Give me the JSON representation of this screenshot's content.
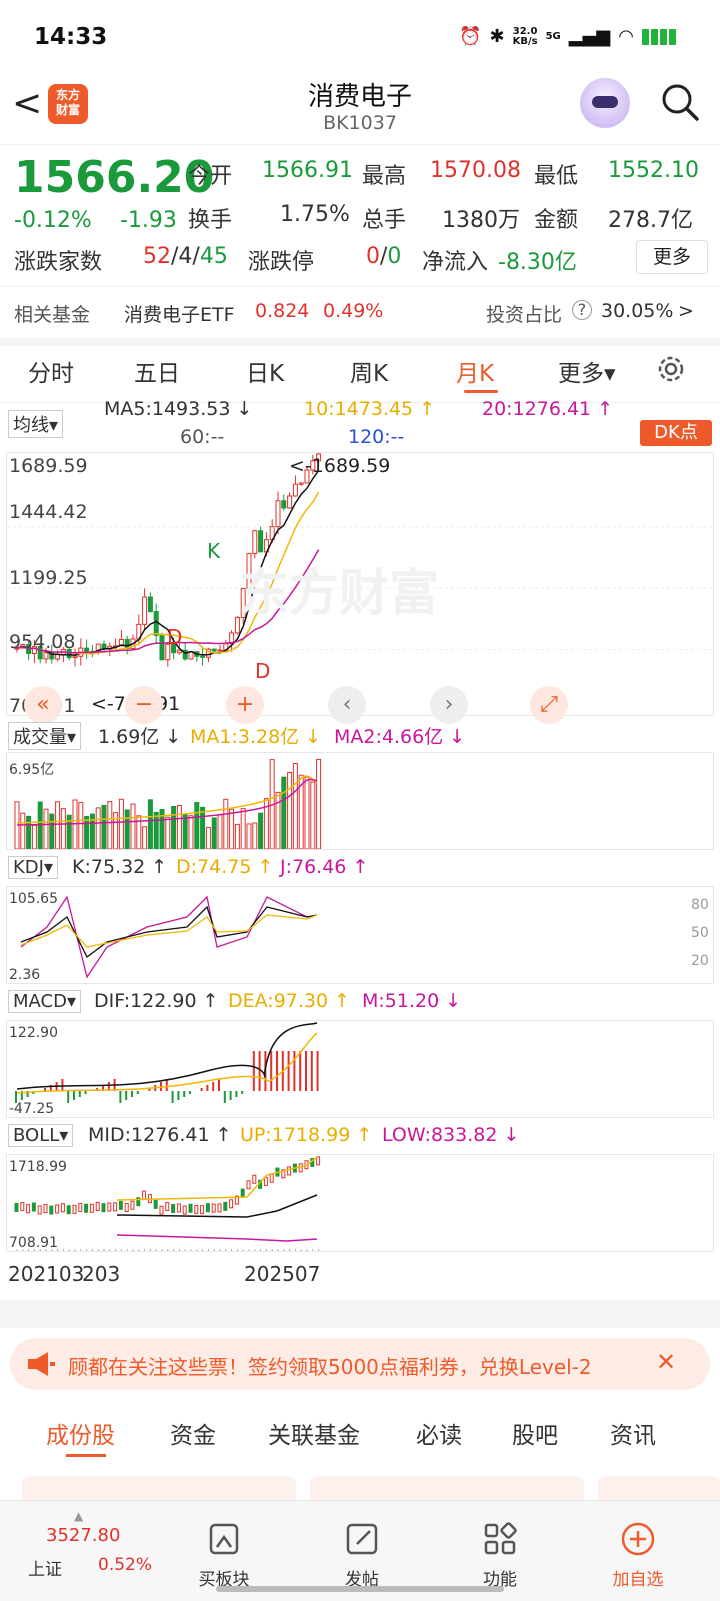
{
  "status": {
    "time": "14:33",
    "net_speed_top": "32.0",
    "net_speed_unit": "KB/s",
    "signal": "5G"
  },
  "nav": {
    "back": "<",
    "logo_top": "东方",
    "logo_bottom": "财富",
    "title": "消费电子",
    "code": "BK1037"
  },
  "quote": {
    "price": "1566.20",
    "pct": "-0.12%",
    "chg": "-1.93",
    "open_label": "今开",
    "open": "1566.91",
    "high_label": "最高",
    "high": "1570.08",
    "low_label": "最低",
    "low": "1552.10",
    "turnover_label": "换手",
    "turnover": "1.75%",
    "volume_label": "总手",
    "volume": "1380万",
    "amount_label": "金额",
    "amount": "278.7亿",
    "breadth_label": "涨跌家数",
    "breadth_up": "52",
    "breadth_flat": "4",
    "breadth_down": "45",
    "limit_label": "涨跌停",
    "limit_up": "0",
    "limit_down": "0",
    "inflow_label": "净流入",
    "inflow": "-8.30亿",
    "more": "更多"
  },
  "fund": {
    "label": "相关基金",
    "name": "消费电子ETF",
    "price": "0.824",
    "pct": "0.49%",
    "ratio_label": "投资占比",
    "ratio": "30.05%",
    "arrow": ">"
  },
  "tabs": [
    "分时",
    "五日",
    "日K",
    "周K",
    "月K",
    "更多▾"
  ],
  "active_tab": "月K",
  "ma": {
    "selector": "均线▾",
    "ma5": "MA5:1493.53 ↓",
    "ma10": "10:1473.45 ↑",
    "ma20": "20:1276.41 ↑",
    "ma60": "60:--",
    "ma120": "120:--",
    "dk": "DK点"
  },
  "kline": {
    "y_labels": [
      "1689.59",
      "1444.42",
      "1199.25",
      "954.08",
      "708.91"
    ],
    "max_label": "<-1689.59",
    "min_label": "<-708.91",
    "watermark": "东方财富",
    "mark_k": "K",
    "mark_d1": "D",
    "mark_d2": "D"
  },
  "controls": [
    "«",
    "−",
    "+",
    "‹",
    "›",
    "⤢"
  ],
  "volume": {
    "selector": "成交量▾",
    "value": "1.69亿 ↓",
    "ma1": "MA1:3.28亿 ↓",
    "ma2": "MA2:4.66亿 ↓",
    "max": "6.95亿"
  },
  "kdj": {
    "selector": "KDJ▾",
    "k": "K:75.32 ↑",
    "d": "D:74.75 ↑",
    "j": "J:76.46 ↑",
    "max": "105.65",
    "min": "2.36",
    "levels": [
      "80",
      "50",
      "20"
    ]
  },
  "macd": {
    "selector": "MACD▾",
    "dif": "DIF:122.90 ↑",
    "dea": "DEA:97.30 ↑",
    "m": "M:51.20 ↓",
    "max": "122.90",
    "min": "-47.25"
  },
  "boll": {
    "selector": "BOLL▾",
    "mid": "MID:1276.41 ↑",
    "up": "UP:1718.99 ↑",
    "low": "LOW:833.82 ↓",
    "max": "1718.99",
    "min": "708.91"
  },
  "x_axis": {
    "start": "202103",
    "start_overlap": "203",
    "end": "202507"
  },
  "banner": {
    "text": "顾都在关注这些票！签约领取5000点福利券，兑换Level-2",
    "close": "✕"
  },
  "sub_tabs": [
    "成份股",
    "资金",
    "关联基金",
    "必读",
    "股吧",
    "资讯"
  ],
  "bottom": {
    "index_value": "3527.80",
    "index_name": "上证",
    "index_pct": "0.52%",
    "items": [
      "买板块",
      "发帖",
      "功能",
      "加自选"
    ]
  },
  "colors": {
    "accent": "#ef5a2a",
    "up": "#e0322b",
    "down": "#1a9a3a",
    "ma5": "#111111",
    "ma10": "#f2b705",
    "ma20": "#c8179b"
  }
}
